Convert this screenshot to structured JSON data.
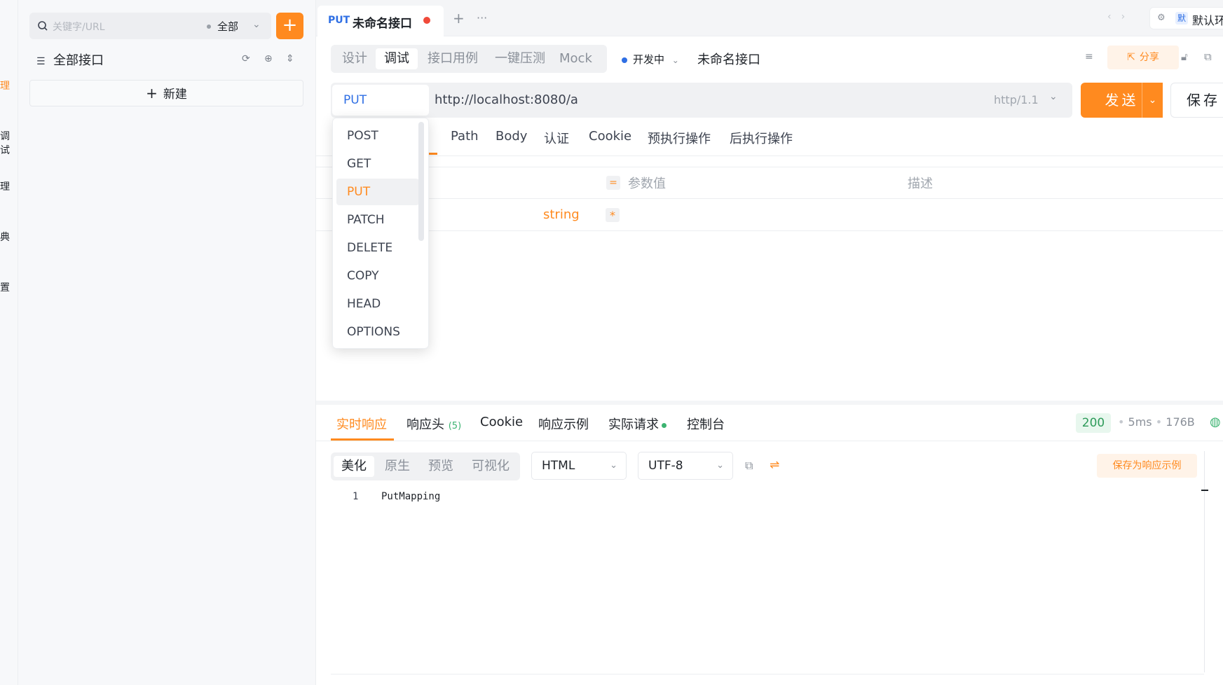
{
  "left_nav": {
    "items": [
      "理",
      "调试",
      "理",
      "典",
      "置"
    ]
  },
  "sidebar": {
    "search": {
      "placeholder": "关键字/URL",
      "scope": "全部"
    },
    "add_label": "+",
    "tree_title": "全部接口",
    "new_label": "新建"
  },
  "tabs": {
    "active": {
      "method": "PUT",
      "title": "未命名接口"
    },
    "add_label": "+",
    "more_label": "···",
    "env_badge": "默",
    "env_name": "默认环"
  },
  "mode_tabs": [
    "设计",
    "调试",
    "接口用例",
    "一键压测",
    "Mock"
  ],
  "mode_active": "调试",
  "status_label": "开发中",
  "api_name": "未命名接口",
  "share_label": "分享",
  "request": {
    "method": "PUT",
    "url": "http://localhost:8080/a",
    "protocol": "http/1.1",
    "send_label": "发送",
    "save_label": "保存"
  },
  "method_dropdown": {
    "options": [
      "POST",
      "GET",
      "PUT",
      "PATCH",
      "DELETE",
      "COPY",
      "HEAD",
      "OPTIONS"
    ],
    "selected": "PUT"
  },
  "param_tabs": [
    "Path",
    "Body",
    "认证",
    "Cookie",
    "预执行操作",
    "后执行操作"
  ],
  "params_table": {
    "eq_symbol": "=",
    "headers": {
      "value": "参数值",
      "desc": "描述"
    },
    "rows": [
      {
        "type": "string",
        "required_mark": "*"
      }
    ]
  },
  "response": {
    "tabs": [
      {
        "label": "实时响应"
      },
      {
        "label": "响应头",
        "count": "(5)"
      },
      {
        "label": "Cookie"
      },
      {
        "label": "响应示例"
      },
      {
        "label": "实际请求"
      },
      {
        "label": "控制台"
      }
    ],
    "status_code": "200",
    "time": "5ms",
    "size": "176B",
    "view_modes": [
      "美化",
      "原生",
      "预览",
      "可视化"
    ],
    "view_active": "美化",
    "format": "HTML",
    "encoding": "UTF-8",
    "save_example_label": "保存为响应示例",
    "lines": [
      {
        "num": "1",
        "text": "PutMapping"
      }
    ]
  },
  "colors": {
    "accent": "#ff8a1f",
    "method_blue": "#2f6fe4",
    "success_green": "#3cb371"
  }
}
